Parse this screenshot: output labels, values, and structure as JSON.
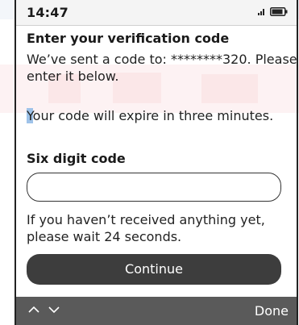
{
  "status_bar": {
    "time": "14:47",
    "signal_icon": "signal-icon",
    "battery_icon": "battery-icon"
  },
  "form": {
    "heading": "Enter your verification code",
    "message": "We’ve sent a code to: ********320. Please enter it below.",
    "expiry_first_letter": "Y",
    "expiry_rest": "our code will expire in three minutes.",
    "code_label": "Six digit code",
    "code_value": "",
    "code_placeholder": "",
    "wait_note": "If you haven’t received anything yet, please wait 24 seconds.",
    "continue_label": "Continue"
  },
  "keyboard_bar": {
    "prev_icon": "chevron-up-icon",
    "next_icon": "chevron-down-icon",
    "done_label": "Done"
  },
  "colors": {
    "button_bg": "#3d3d3d",
    "keyboard_bar_bg": "#5a5a5a",
    "status_bar_bg": "#f4f4f4",
    "cursor_highlight": "#9fc3e9",
    "watermark_red": "#d9262b",
    "watermark_blue": "#1a4a9a"
  }
}
